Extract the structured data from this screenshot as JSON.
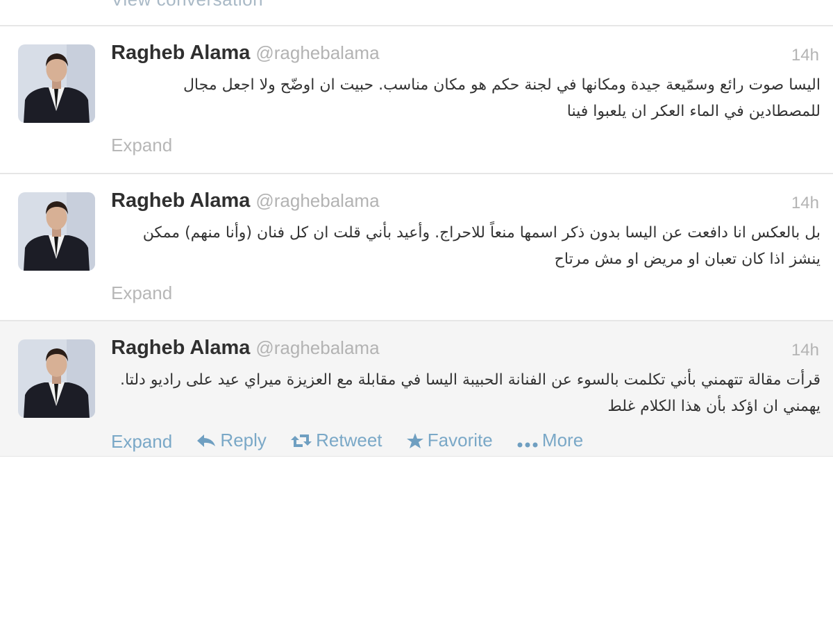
{
  "previous_tweet": {
    "link_label": "View conversation"
  },
  "tweets": [
    {
      "fullname": "Ragheb Alama",
      "username": "@raghebalama",
      "time": "14h",
      "text": "اليسا صوت رائع وسمّيعة جيدة ومكانها في لجنة حكم هو مكان مناسب. حبيت ان اوضّح ولا اجعل مجال للمصطادين في الماء العكر ان يلعبوا فينا",
      "actions": {
        "expand": "Expand"
      }
    },
    {
      "fullname": "Ragheb Alama",
      "username": "@raghebalama",
      "time": "14h",
      "text": "بل بالعكس انا دافعت عن اليسا بدون ذكر اسمها منعاً للاحراج. وأعيد بأني قلت ان كل فنان (وأنا منهم) ممكن ينشز اذا كان تعبان او مريض او مش مرتاح",
      "actions": {
        "expand": "Expand"
      }
    },
    {
      "fullname": "Ragheb Alama",
      "username": "@raghebalama",
      "time": "14h",
      "text": "قرأت مقالة تتهمني بأني تكلمت بالسوء عن الفنانة الحبيبة اليسا في مقابلة مع العزيزة ميراي عيد على راديو دلتا. يهمني ان اؤكد بأن هذا الكلام غلط",
      "actions": {
        "expand": "Expand",
        "reply": "Reply",
        "retweet": "Retweet",
        "favorite": "Favorite",
        "more": "More"
      },
      "icons": {
        "reply": "reply-arrow-icon",
        "retweet": "retweet-icon",
        "favorite": "star-icon",
        "more": "ellipsis-icon"
      }
    }
  ],
  "colors": {
    "action_link": "#7aa8c7",
    "muted": "#b3b3b3",
    "name": "#2f2f2f",
    "hover_bg": "#f5f5f5"
  }
}
